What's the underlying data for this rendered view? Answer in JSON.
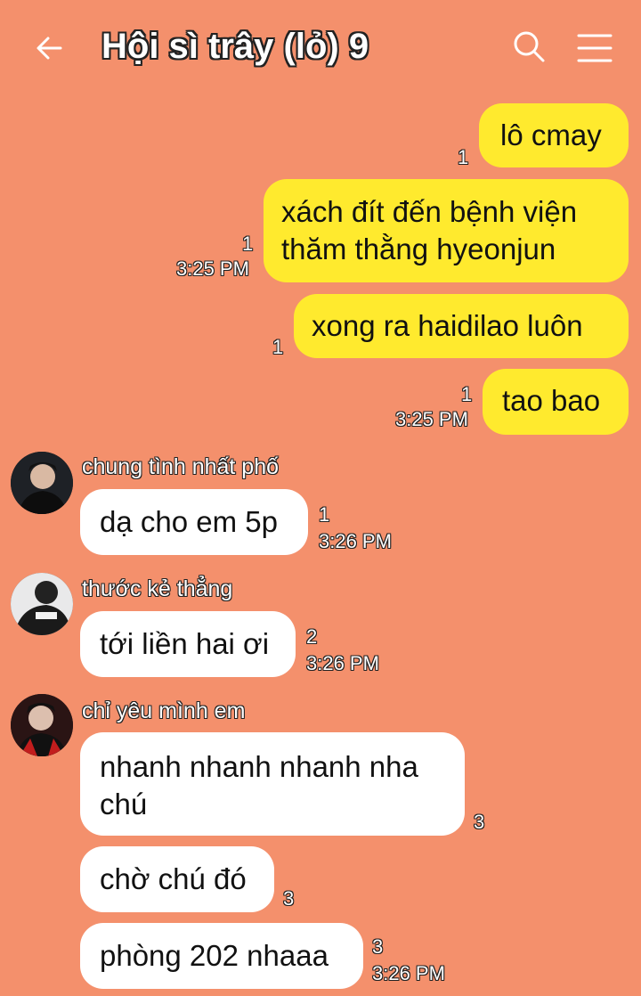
{
  "header": {
    "title": "Hội sì trây (lỏ) 9",
    "back_icon": "arrow-left-icon",
    "search_icon": "search-icon",
    "menu_icon": "hamburger-menu-icon"
  },
  "colors": {
    "background": "#f4906c",
    "outgoing_bubble": "#ffea2e",
    "incoming_bubble": "#ffffff"
  },
  "outgoing": [
    {
      "text": "lô cmay",
      "count": "1",
      "time": ""
    },
    {
      "line1": "xách đít đến bệnh viện",
      "line2": "thăm thằng hyeonjun",
      "count": "1",
      "time": "3:25 PM"
    },
    {
      "text": "xong ra haidilao luôn",
      "count": "1",
      "time": ""
    },
    {
      "text": "tao bao",
      "count": "1",
      "time": "3:25 PM"
    }
  ],
  "incoming": [
    {
      "sender": "chung tình nhất phố",
      "text": "dạ cho em 5p",
      "count": "1",
      "time": "3:26 PM"
    },
    {
      "sender": "thước kẻ thẳng",
      "text": "tới liền hai ơi",
      "count": "2",
      "time": "3:26 PM"
    },
    {
      "sender": "chỉ yêu mình em",
      "line1": "nhanh nhanh nhanh nha",
      "line2": "chú",
      "count": "3",
      "time": ""
    },
    {
      "text": "chờ chú đó",
      "count": "3",
      "time": ""
    },
    {
      "text": "phòng 202 nhaaa",
      "count": "3",
      "time": "3:26 PM"
    }
  ]
}
